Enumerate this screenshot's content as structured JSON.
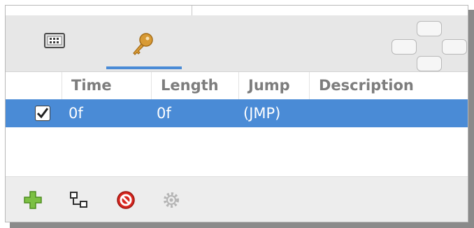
{
  "tabs": [
    {
      "name": "info",
      "icon": "info-panel-icon",
      "active": false
    },
    {
      "name": "keyframes",
      "icon": "key-icon",
      "active": true
    }
  ],
  "table": {
    "columns": [
      "",
      "Time",
      "Length",
      "Jump",
      "Description"
    ],
    "rows": [
      {
        "checked": true,
        "time": "0f",
        "length": "0f",
        "jump": "(JMP)",
        "description": ""
      }
    ]
  },
  "toolbar": {
    "icons": [
      "add-icon",
      "link-icon",
      "delete-icon",
      "settings-icon"
    ]
  },
  "colors": {
    "selection": "#4a8bd6",
    "tab_indicator": "#4a8bd6"
  }
}
